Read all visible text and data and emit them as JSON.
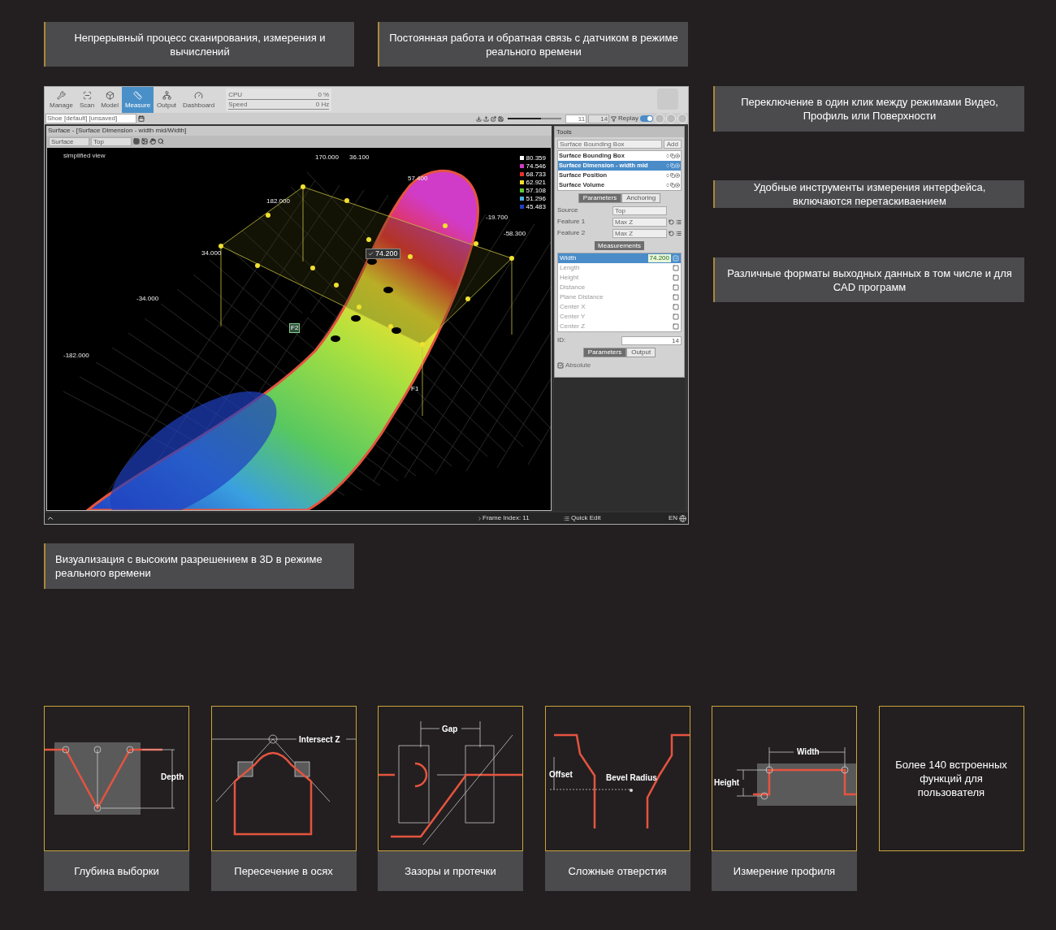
{
  "top_callouts": [
    "Непрерывный процесс сканирования, измерения и вычислений",
    "Постоянная работа и обратная связь с датчиком в режиме реального времени"
  ],
  "app": {
    "ribbon_tabs": [
      {
        "label": "Manage",
        "selected": false
      },
      {
        "label": "Scan",
        "selected": false
      },
      {
        "label": "Model",
        "selected": false
      },
      {
        "label": "Measure",
        "selected": true
      },
      {
        "label": "Output",
        "selected": false
      },
      {
        "label": "Dashboard",
        "selected": false
      }
    ],
    "stats": [
      {
        "label": "CPU",
        "value": "0 %"
      },
      {
        "label": "Speed",
        "value": "0 Hz"
      }
    ],
    "job_select": "Shoe [default] [unsaved]",
    "frame_slider": {
      "level": 0.62
    },
    "frame_fields": [
      "11",
      "14"
    ],
    "replay_toggle": {
      "on": true
    },
    "replay_label": "Replay",
    "view": {
      "title": "Surface - [Surface Dimension - width mid/Width]",
      "selects": [
        "Surface",
        "Top"
      ],
      "mode_label": "simplified view",
      "axis_labels": [
        "170.000",
        "36.100",
        "57.400",
        "182.000",
        "-19.700",
        "-58.300",
        "34.000",
        "-34.000",
        "-182.000"
      ],
      "legend": [
        {
          "value": "80.359",
          "color": "#ffffff"
        },
        {
          "value": "74.546",
          "color": "#d03cc8"
        },
        {
          "value": "68.733",
          "color": "#e83030"
        },
        {
          "value": "62.921",
          "color": "#f0e030"
        },
        {
          "value": "57.108",
          "color": "#60c830"
        },
        {
          "value": "51.296",
          "color": "#50b0e0"
        },
        {
          "value": "45.483",
          "color": "#2040c0"
        }
      ],
      "measurement_tag": "74.200",
      "feature_tags": [
        "F2",
        "F1"
      ]
    },
    "tools": {
      "title": "Tools",
      "tool_select": "Surface Bounding Box",
      "add_button": "Add",
      "items": [
        {
          "label": "Surface Bounding Box",
          "selected": false
        },
        {
          "label": "Surface Dimension - width mid",
          "selected": true
        },
        {
          "label": "Surface Position",
          "selected": false
        },
        {
          "label": "Surface Volume",
          "selected": false
        }
      ],
      "param_tabs": [
        {
          "label": "Parameters",
          "selected": true
        },
        {
          "label": "Anchoring",
          "selected": false
        }
      ],
      "params": [
        {
          "label": "Source",
          "value": "Top",
          "kind": "select"
        },
        {
          "label": "Feature 1",
          "value": "Max Z",
          "kind": "feature"
        },
        {
          "label": "Feature 2",
          "value": "Max Z",
          "kind": "feature"
        }
      ],
      "measurements_header": "Measurements",
      "measurements": [
        {
          "label": "Width",
          "value": "74.200",
          "checked": true,
          "selected": true
        },
        {
          "label": "Length",
          "checked": false,
          "selected": false
        },
        {
          "label": "Height",
          "checked": false,
          "selected": false
        },
        {
          "label": "Distance",
          "checked": false,
          "selected": false
        },
        {
          "label": "Plane Distance",
          "checked": false,
          "selected": false
        },
        {
          "label": "Center X",
          "checked": false,
          "selected": false
        },
        {
          "label": "Center Y",
          "checked": false,
          "selected": false
        },
        {
          "label": "Center Z",
          "checked": false,
          "selected": false
        }
      ],
      "id_label": "ID:",
      "id_value": "14",
      "output_tabs": [
        {
          "label": "Parameters",
          "selected": true
        },
        {
          "label": "Output",
          "selected": false
        }
      ],
      "absolute": {
        "label": "Absolute",
        "checked": true
      }
    },
    "status": {
      "frame_index": "Frame Index: 11",
      "quick_edit": "Quick Edit",
      "language": "EN"
    }
  },
  "side_callouts": [
    "Переключение в один клик между режимами Видео, Профиль или Поверхности",
    "Удобные инструменты измерения интерфейса, включаются перетаскиваением",
    "Различные форматы выходных данных в том числе и для CAD программ"
  ],
  "bottom_callout": "Визуализация с высоким разрешением в 3D в режиме реального времени",
  "feature_cards": [
    {
      "kind": "depth",
      "labels": [
        "Depth"
      ],
      "caption": "Глубина выборки"
    },
    {
      "kind": "intersect",
      "labels": [
        "Intersect Z"
      ],
      "caption": "Пересечение в осях"
    },
    {
      "kind": "gap",
      "labels": [
        "Gap"
      ],
      "caption": "Зазоры и протечки"
    },
    {
      "kind": "bevel",
      "labels": [
        "Offset",
        "Bevel Radius"
      ],
      "caption": "Сложные отверстия"
    },
    {
      "kind": "profile",
      "labels": [
        "Width",
        "Height"
      ],
      "caption": "Измерение профиля"
    },
    {
      "kind": "text",
      "text": "Более 140 встроенных функций для пользователя"
    }
  ]
}
